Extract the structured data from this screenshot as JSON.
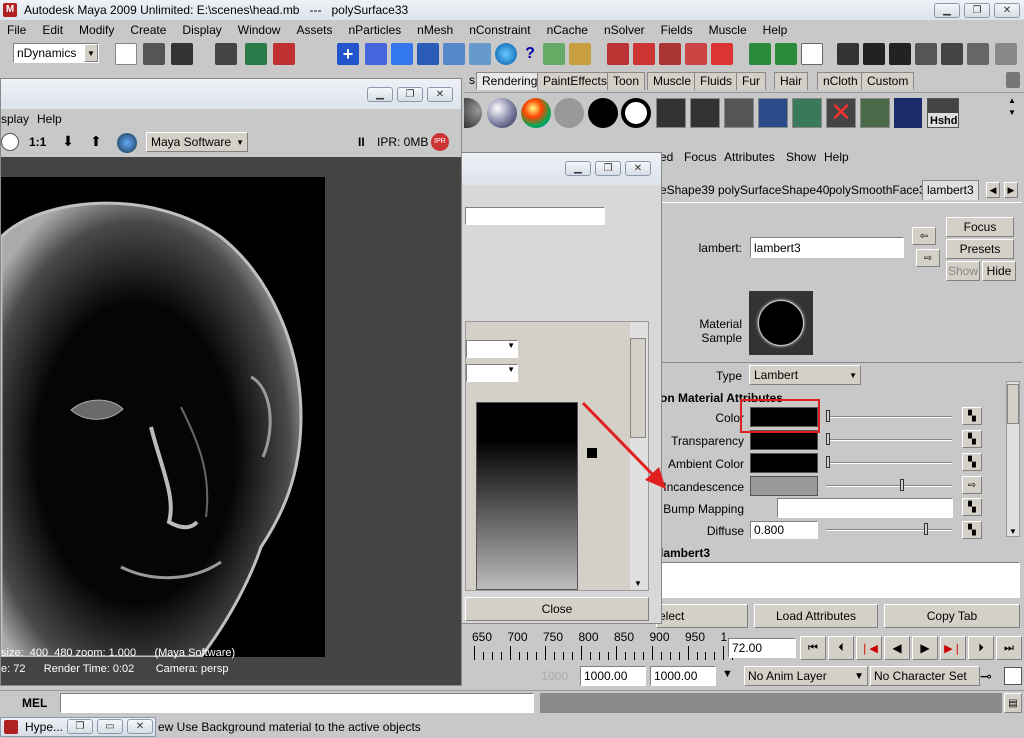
{
  "app": {
    "title": "Autodesk Maya 2009 Unlimited: E:\\scenes\\head.mb   ---   polySurface33"
  },
  "menubar": [
    "File",
    "Edit",
    "Modify",
    "Create",
    "Display",
    "Window",
    "Assets",
    "nParticles",
    "nMesh",
    "nConstraint",
    "nCache",
    "nSolver",
    "Fields",
    "Muscle",
    "Help"
  ],
  "toolbar": {
    "menuset": "nDynamics"
  },
  "shelf_tabs": [
    "s",
    "Rendering",
    "PaintEffects",
    "Toon",
    "Muscle",
    "Fluids",
    "Fur",
    "Hair",
    "nCloth",
    "Custom"
  ],
  "shelf": {
    "hshd_label": "Hshd"
  },
  "render_view": {
    "menu": [
      "splay",
      "Help"
    ],
    "ratio_label": "1:1",
    "renderer": "Maya Software",
    "ipr_label": "IPR: 0MB",
    "ipr_badge": "IPR",
    "info_line1": "size:  400  480 zoom: 1.000      (Maya Software)",
    "info_line2": "e: 72      Render Time: 0:02       Camera: persp"
  },
  "color_chooser": {
    "close_label": "Close"
  },
  "attribute_editor": {
    "menu": [
      "ed",
      "Focus",
      "Attributes",
      "Show",
      "Help"
    ],
    "tabs": [
      "eShape39",
      "polySurfaceShape40",
      "polySmoothFace3",
      "lambert3"
    ],
    "node_label": "lambert:",
    "node_value": "lambert3",
    "focus_label": "Focus",
    "presets_label": "Presets",
    "show_label": "Show",
    "hide_label": "Hide",
    "material_sample_label": "Material Sample",
    "type_label": "Type",
    "type_value": "Lambert",
    "section_title": "on Material Attributes",
    "attrs": [
      {
        "label": "Color"
      },
      {
        "label": "Transparency"
      },
      {
        "label": "Ambient Color"
      },
      {
        "label": "Incandescence"
      },
      {
        "label": "Bump Mapping"
      },
      {
        "label": "Diffuse",
        "value": "0.800"
      }
    ],
    "notes_label": "lambert3",
    "select_label": "elect",
    "load_label": "Load Attributes",
    "copy_label": "Copy Tab"
  },
  "timeline": {
    "ticks": [
      "650",
      "700",
      "750",
      "800",
      "850",
      "900",
      "950",
      "1"
    ],
    "current_frame": "72.00",
    "start_grey": "1000",
    "range_start": "1000.00",
    "range_end": "1000.00",
    "anim_layer": "No Anim Layer",
    "char_set": "No Character Set"
  },
  "command": {
    "mel_label": "MEL"
  },
  "status": {
    "help_text": "ew Use Background material to the active objects",
    "taskbar_label": "Hype..."
  },
  "colors": {
    "highlight_red": "#e02020",
    "maya_bg": "#c8c8c8"
  }
}
